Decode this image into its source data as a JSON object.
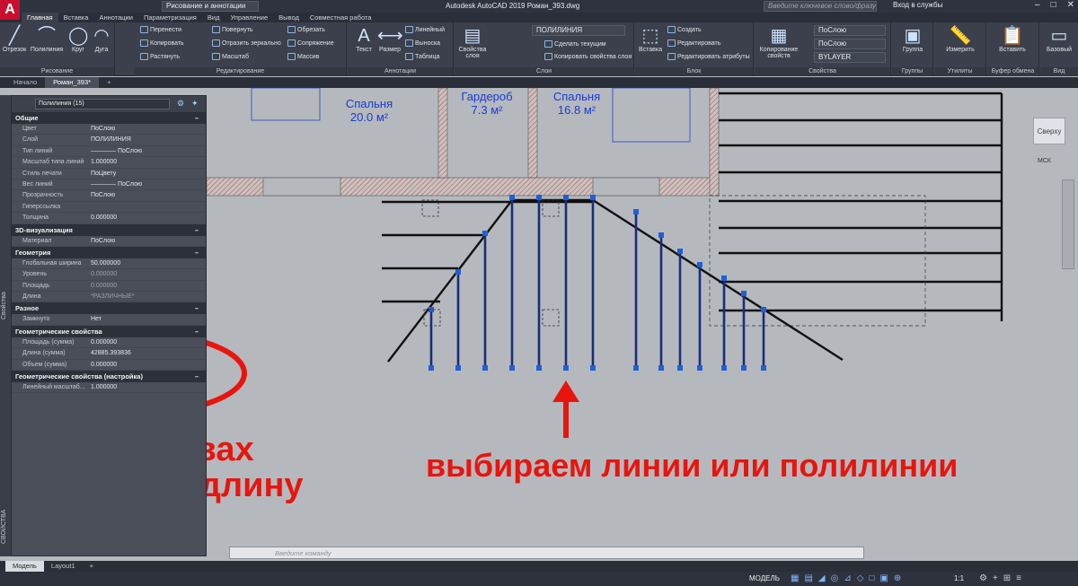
{
  "app": {
    "title": "Autodesk AutoCAD 2019    Роман_393.dwg",
    "workspace": "Рисование и аннотации",
    "search_placeholder": "Введите ключевое слово/фразу",
    "login": "Вход в службы"
  },
  "ribbon_tabs": [
    "Главная",
    "Вставка",
    "Аннотации",
    "Параметризация",
    "Вид",
    "Управление",
    "Вывод",
    "Совместная работа"
  ],
  "panels": {
    "draw": {
      "title": "Рисование",
      "items": [
        "Отрезок",
        "Полилиния",
        "Круг",
        "Дуга"
      ]
    },
    "modify": {
      "title": "Редактирование",
      "items": [
        "Перенести",
        "Повернуть",
        "Обрезать",
        "Копировать",
        "Отразить зеркально",
        "Сопряжение",
        "Растянуть",
        "Масштаб",
        "Массив"
      ]
    },
    "annotation": {
      "title": "Аннотации",
      "items": [
        "Текст",
        "Размер",
        "Линейный",
        "Выноска",
        "Таблица"
      ]
    },
    "layers": {
      "title": "Слои",
      "items": [
        "Свойства слоя",
        "ПОЛИЛИНИЯ",
        "Сделать текущим",
        "Копировать свойства слоя"
      ]
    },
    "block": {
      "title": "Блок",
      "items": [
        "Вставка",
        "Создать",
        "Редактировать",
        "Редактировать атрибуты"
      ]
    },
    "properties": {
      "title": "Свойства",
      "items": [
        "Копирование свойств",
        "ПоСлою",
        "ПоСлою",
        "BYLAYER"
      ]
    },
    "groups": {
      "title": "Группы",
      "items": [
        "Группа"
      ]
    },
    "utilities": {
      "title": "Утилиты",
      "items": [
        "Измерить"
      ]
    },
    "clipboard": {
      "title": "Буфер обмена",
      "items": [
        "Вставить"
      ]
    },
    "view": {
      "title": "Вид",
      "items": [
        "Базовый"
      ]
    }
  },
  "file_tabs": [
    "Начало",
    "Роман_393*"
  ],
  "palette": {
    "selection": "Полилиния (15)",
    "side_label": "Свойства",
    "side_label_bottom": "СВОЙСТВА",
    "sections": [
      {
        "title": "Общие",
        "rows": [
          [
            "Цвет",
            "ПоСлою"
          ],
          [
            "Слой",
            "ПОЛИЛИНИЯ"
          ],
          [
            "Тип линий",
            "———— ПоСлою"
          ],
          [
            "Масштаб типа линий",
            "1.000000"
          ],
          [
            "Стиль печати",
            "ПоЦвету"
          ],
          [
            "Вес линий",
            "———— ПоСлою"
          ],
          [
            "Прозрачность",
            "ПоСлою"
          ],
          [
            "Гиперссылка",
            ""
          ],
          [
            "Толщина",
            "0.000000"
          ]
        ]
      },
      {
        "title": "3D-визуализация",
        "rows": [
          [
            "Материал",
            "ПоСлою"
          ]
        ]
      },
      {
        "title": "Геометрия",
        "rows": [
          [
            "Глобальная ширина",
            "50.000000"
          ],
          [
            "Уровень",
            "0.000000"
          ],
          [
            "Площадь",
            "0.000000"
          ],
          [
            "Длина",
            "*РАЗЛИЧНЫЕ*"
          ]
        ]
      },
      {
        "title": "Разное",
        "rows": [
          [
            "Замкнуто",
            "Нет"
          ]
        ]
      },
      {
        "title": "Геометрические свойства",
        "rows": [
          [
            "Площадь (сумма)",
            "0.000000"
          ],
          [
            "Длина (сумма)",
            "42885.393836"
          ],
          [
            "Объем (сумма)",
            "0.000000"
          ]
        ]
      },
      {
        "title": "Геометрические свойства (настройка)",
        "rows": [
          [
            "Линейный масштаб...",
            "1.000000"
          ]
        ]
      }
    ]
  },
  "drawing": {
    "rooms": [
      {
        "name": "Спальня",
        "area": "20.0 м²"
      },
      {
        "name": "Гардероб",
        "area": "7.3 м²"
      },
      {
        "name": "Спальня",
        "area": "16.8 м²"
      }
    ]
  },
  "annotations": {
    "left": [
      "в Свойствах",
      "смотрим длину"
    ],
    "bottom": "выбираем линии или полилинии",
    "color": "#e8150e"
  },
  "viewcube": {
    "face": "Сверху",
    "ucs": "МСК"
  },
  "command": {
    "placeholder": "Введите  команду"
  },
  "layout_tabs": [
    "Модель",
    "Layout1"
  ],
  "status": {
    "mode": "МОДЕЛЬ",
    "scale": "1:1"
  }
}
